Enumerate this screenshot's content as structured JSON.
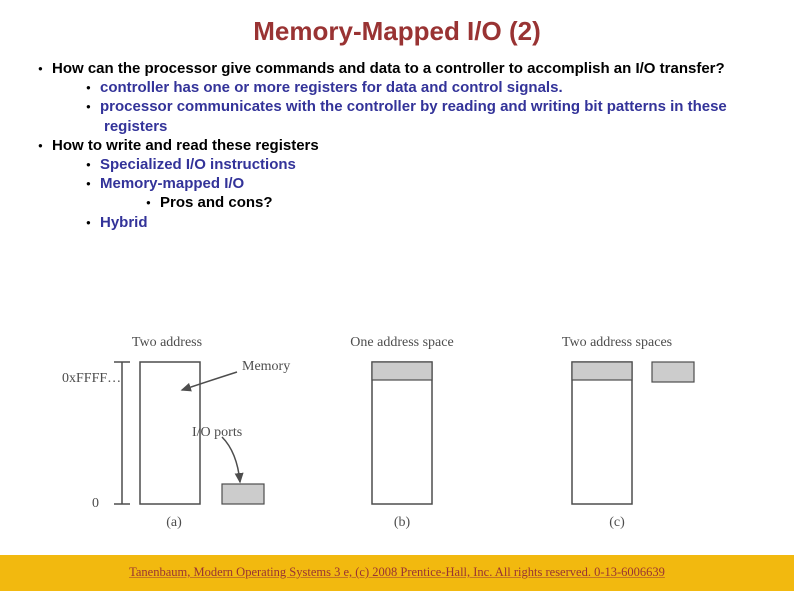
{
  "title": "Memory-Mapped I/O (2)",
  "bullets": {
    "b1": "How can the processor give commands and data to a controller to accomplish an I/O transfer?",
    "b1a": "controller has one or more registers for data and control signals.",
    "b1b": "processor communicates with the controller by reading and writing bit patterns in these registers",
    "b2": "How to write and read these registers",
    "b2a": "Specialized I/O instructions",
    "b2b": "Memory-mapped I/O",
    "b2b1": "Pros and cons?",
    "b2c": "Hybrid"
  },
  "figure": {
    "col_a": "Two address",
    "col_b": "One address space",
    "col_c": "Two address spaces",
    "hex": "0xFFFF…",
    "zero": "0",
    "memory": "Memory",
    "ioports": "I/O ports",
    "sub_a": "(a)",
    "sub_b": "(b)",
    "sub_c": "(c)"
  },
  "footer": "Tanenbaum, Modern Operating Systems 3 e, (c) 2008 Prentice-Hall, Inc. All rights reserved. 0-13-6006639"
}
